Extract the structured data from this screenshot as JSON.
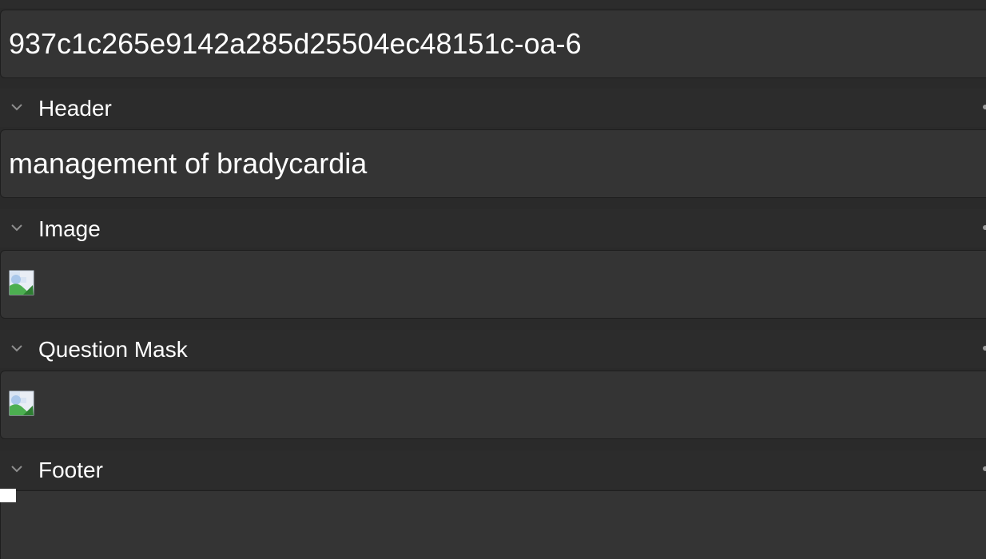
{
  "fields": [
    {
      "key": "id",
      "value": "937c1c265e9142a285d25504ec48151c-oa-6"
    },
    {
      "key": "header_label",
      "label": "Header"
    },
    {
      "key": "header",
      "value": "management of bradycardia"
    },
    {
      "key": "image_label",
      "label": "Image"
    },
    {
      "key": "question_mask_label",
      "label": "Question Mask"
    },
    {
      "key": "footer_label",
      "label": "Footer"
    }
  ],
  "icons": {
    "collapse": "chevron-down-icon",
    "broken_image": "broken-image-icon"
  },
  "colors": {
    "background": "#2a2a2a",
    "field_background": "#343434",
    "text": "#ffffff",
    "image_green": "#4caf50",
    "image_blue": "#a9c7ea"
  }
}
